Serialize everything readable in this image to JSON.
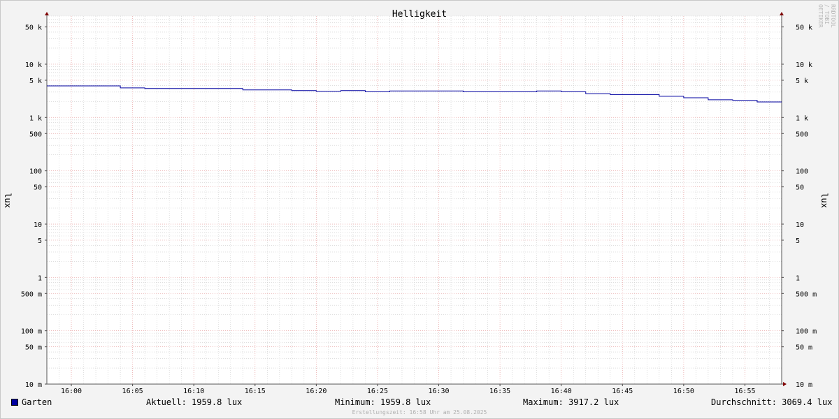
{
  "chart_data": {
    "type": "line",
    "title": "Helligkeit",
    "ylabel_left": "lux",
    "ylabel_right": "lux",
    "y_scale": "log",
    "ylim": [
      0.01,
      80000
    ],
    "xlim": [
      "15:58",
      "16:58"
    ],
    "x_tick_labels": [
      "16:00",
      "16:05",
      "16:10",
      "16:15",
      "16:20",
      "16:25",
      "16:30",
      "16:35",
      "16:40",
      "16:45",
      "16:50",
      "16:55"
    ],
    "y_ticks": [
      {
        "value": 50000,
        "label": "50 k"
      },
      {
        "value": 10000,
        "label": "10 k"
      },
      {
        "value": 5000,
        "label": "5 k"
      },
      {
        "value": 1000,
        "label": "1 k"
      },
      {
        "value": 500,
        "label": "500"
      },
      {
        "value": 100,
        "label": "100"
      },
      {
        "value": 50,
        "label": "50"
      },
      {
        "value": 10,
        "label": "10"
      },
      {
        "value": 5,
        "label": "5"
      },
      {
        "value": 1,
        "label": "1"
      },
      {
        "value": 0.5,
        "label": "500 m"
      },
      {
        "value": 0.1,
        "label": "100 m"
      },
      {
        "value": 0.05,
        "label": "50 m"
      },
      {
        "value": 0.01,
        "label": "10 m"
      }
    ],
    "series": [
      {
        "name": "Garten",
        "color": "#0000a0",
        "x": [
          "15:58",
          "16:04",
          "16:06",
          "16:14",
          "16:18",
          "16:20",
          "16:22",
          "16:24",
          "16:26",
          "16:32",
          "16:38",
          "16:40",
          "16:42",
          "16:44",
          "16:48",
          "16:50",
          "16:52",
          "16:54",
          "16:56",
          "16:58"
        ],
        "values": [
          3917.2,
          3600,
          3500,
          3300,
          3200,
          3100,
          3200,
          3050,
          3150,
          3050,
          3150,
          3050,
          2800,
          2700,
          2500,
          2350,
          2150,
          2100,
          1959.8,
          1959.8
        ]
      }
    ],
    "grid": true
  },
  "legend": {
    "series_name": "Garten",
    "current": "Aktuell: 1959.8 lux",
    "minimum": "Minimum: 1959.8 lux",
    "maximum": "Maximum: 3917.2 lux",
    "average": "Durchschnitt: 3069.4 lux"
  },
  "footer": "Erstellungszeit: 16:58 Uhr am 25.08.2025",
  "watermark": "RRDTOOL / TOBI OETIKER",
  "colors": {
    "major_grid": "#e8a0a0",
    "minor_grid": "#cccccc",
    "line": "#0000a0",
    "arrow": "#800000"
  }
}
